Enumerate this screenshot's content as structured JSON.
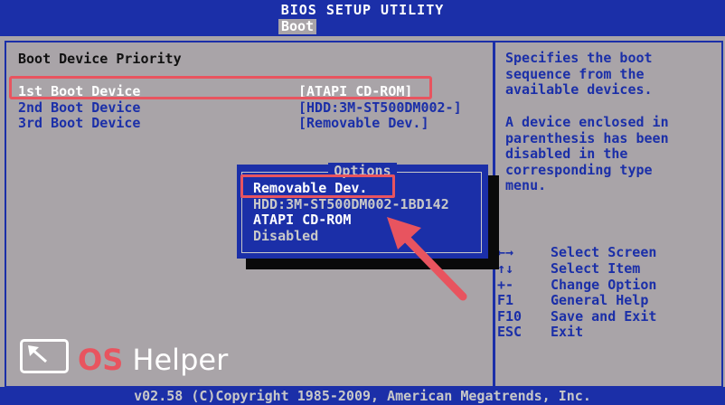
{
  "header": {
    "title": "BIOS SETUP UTILITY",
    "active_tab": "Boot"
  },
  "main": {
    "section_title": "Boot Device Priority",
    "rows": [
      {
        "label": "1st Boot Device",
        "value": "[ATAPI CD-ROM]"
      },
      {
        "label": "2nd Boot Device",
        "value": "[HDD:3M-ST500DM002-]"
      },
      {
        "label": "3rd Boot Device",
        "value": "[Removable Dev.]"
      }
    ]
  },
  "popup": {
    "title": "Options",
    "options": [
      "Removable Dev.",
      "HDD:3M-ST500DM002-1BD142",
      "ATAPI CD-ROM",
      "Disabled"
    ]
  },
  "help": {
    "text1": "Specifies the boot\nsequence from the\navailable devices.",
    "text2": "A device enclosed in\nparenthesis has been\ndisabled in the\ncorresponding type\nmenu.",
    "keys": [
      {
        "key": "←→",
        "desc": "Select Screen"
      },
      {
        "key": "↑↓",
        "desc": "Select Item"
      },
      {
        "key": "+-",
        "desc": "Change Option"
      },
      {
        "key": "F1",
        "desc": "General Help"
      },
      {
        "key": "F10",
        "desc": "Save and Exit"
      },
      {
        "key": "ESC",
        "desc": "Exit"
      }
    ]
  },
  "footer": {
    "text": "v02.58 (C)Copyright 1985-2009, American Megatrends, Inc."
  },
  "watermark": {
    "os": "OS",
    "helper": "Helper"
  },
  "colors": {
    "bios_blue": "#1b2fa8",
    "bios_gray": "#a9a4a8",
    "highlight_red": "#e8545f"
  }
}
